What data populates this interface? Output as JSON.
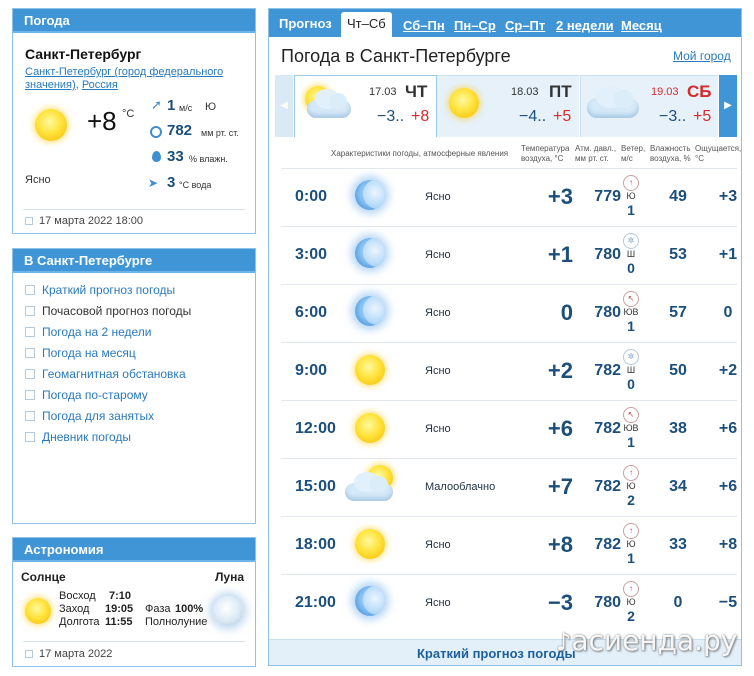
{
  "sidebar_weather": {
    "header": "Погода",
    "city": "Санкт-Петербург",
    "region_line1": "Санкт-Петербург (город федерального",
    "region_line2": "значения)",
    "country": "Россия",
    "temperature": "+8",
    "temperature_unit": "°C",
    "condition": "Ясно",
    "wind_value": "1",
    "wind_unit": "м/с",
    "wind_direction": "Ю",
    "pressure_value": "782",
    "pressure_unit": "мм рт. ст.",
    "humidity_value": "33",
    "humidity_unit": "% влажн.",
    "water_value": "3",
    "water_unit": "°C вода",
    "timestamp": "17 марта 2022 18:00"
  },
  "sidebar_links": {
    "header": "В Санкт-Петербурге",
    "items": [
      {
        "label": "Краткий прогноз погоды"
      },
      {
        "label": "Почасовой прогноз погоды"
      },
      {
        "label": "Погода на 2 недели"
      },
      {
        "label": "Погода на месяц"
      },
      {
        "label": "Геомагнитная обстановка"
      },
      {
        "label": "Погода по-старому"
      },
      {
        "label": "Погода для занятых"
      },
      {
        "label": "Дневник погоды"
      }
    ]
  },
  "astronomy": {
    "header": "Астрономия",
    "sun_label": "Солнце",
    "moon_label": "Луна",
    "sunrise_label": "Восход",
    "sunrise": "7:10",
    "sunset_label": "Заход",
    "sunset": "19:05",
    "daylength_label": "Долгота",
    "daylength": "11:55",
    "phase_label": "Фаза",
    "phase": "100%",
    "phase_name": "Полнолуние",
    "timestamp": "17 марта 2022"
  },
  "main": {
    "tabs": [
      {
        "label": "Прогноз"
      },
      {
        "label": "Чт–Сб"
      },
      {
        "label": "Сб–Пн"
      },
      {
        "label": "Пн–Ср"
      },
      {
        "label": "Ср–Пт"
      },
      {
        "label": "2 недели"
      },
      {
        "label": "Месяц"
      }
    ],
    "title": "Погода в Санкт-Петербурге",
    "my_city": "Мой город",
    "days": [
      {
        "date": "17.03",
        "dow": "ЧТ",
        "low": "−3..",
        "high": "+8"
      },
      {
        "date": "18.03",
        "dow": "ПТ",
        "low": "−4..",
        "high": "+5"
      },
      {
        "date": "19.03",
        "dow": "СБ",
        "low": "−3..",
        "high": "+5"
      }
    ],
    "columns": {
      "conditions": "Характеристики погоды, атмосферные явления",
      "temp1": "Температура",
      "temp2": "воздуха, °С",
      "press1": "Атм. давл.,",
      "press2": "мм рт. ст.",
      "wind1": "Ветер,",
      "wind2": "м/с",
      "hum1": "Влажность",
      "hum2": "воздуха, %",
      "feels1": "Ощущается,",
      "feels2": "°С"
    },
    "rows": [
      {
        "time": "0:00",
        "icon": "moon-icon",
        "cond": "Ясно",
        "temp": "+3",
        "press": "779",
        "wind_dir": "Ю",
        "wind": "1",
        "hum": "49",
        "feels": "+3"
      },
      {
        "time": "3:00",
        "icon": "moon-icon",
        "cond": "Ясно",
        "temp": "+1",
        "press": "780",
        "wind_dir": "Ш",
        "wind": "0",
        "hum": "53",
        "feels": "+1"
      },
      {
        "time": "6:00",
        "icon": "moon-icon",
        "cond": "Ясно",
        "temp": "0",
        "press": "780",
        "wind_dir": "ЮВ",
        "wind": "1",
        "hum": "57",
        "feels": "0"
      },
      {
        "time": "9:00",
        "icon": "sun-icon",
        "cond": "Ясно",
        "temp": "+2",
        "press": "782",
        "wind_dir": "Ш",
        "wind": "0",
        "hum": "50",
        "feels": "+2"
      },
      {
        "time": "12:00",
        "icon": "sun-icon",
        "cond": "Ясно",
        "temp": "+6",
        "press": "782",
        "wind_dir": "ЮВ",
        "wind": "1",
        "hum": "38",
        "feels": "+6"
      },
      {
        "time": "15:00",
        "icon": "sun-cloud-icon",
        "cond": "Малооблачно",
        "temp": "+7",
        "press": "782",
        "wind_dir": "Ю",
        "wind": "2",
        "hum": "34",
        "feels": "+6"
      },
      {
        "time": "18:00",
        "icon": "sun-icon",
        "cond": "Ясно",
        "temp": "+8",
        "press": "782",
        "wind_dir": "Ю",
        "wind": "1",
        "hum": "33",
        "feels": "+8"
      },
      {
        "time": "21:00",
        "icon": "moon-icon",
        "cond": "Ясно",
        "temp": "−3",
        "press": "780",
        "wind_dir": "Ю",
        "wind": "2",
        "hum": "0",
        "feels": "−5"
      }
    ],
    "footer_link": "Краткий прогноз погоды"
  },
  "watermark": "асиенда.ру",
  "colors": {
    "accent": "#3f95d6",
    "red": "#d62b2b",
    "text_blue": "#1c4f7b",
    "link": "#2a79bb"
  }
}
